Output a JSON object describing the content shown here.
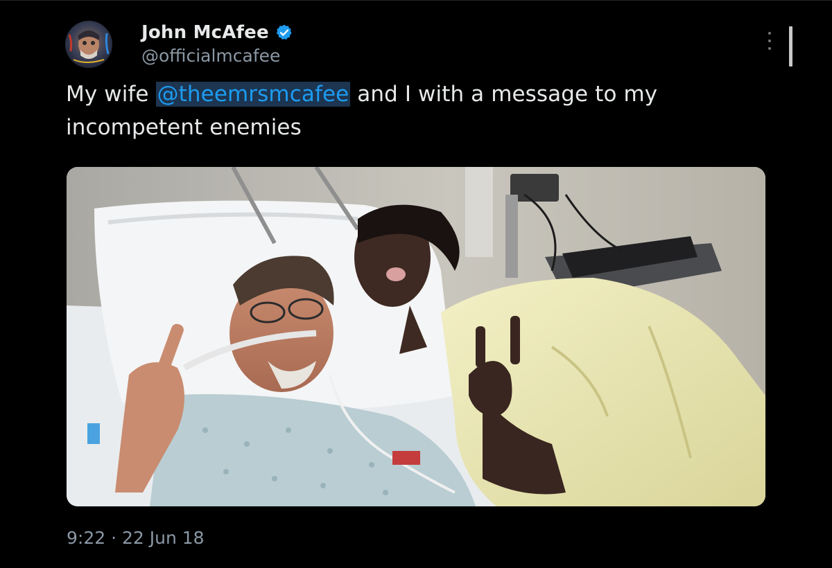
{
  "tweet": {
    "author": {
      "display_name": "John McAfee",
      "handle": "@officialmcafee",
      "verified": true,
      "avatar_icon": "profile-avatar"
    },
    "text_before": "My wife ",
    "mention": "@theemrsmcafee",
    "text_after": " and I with a message to my incompetent enemies",
    "time": "9:22",
    "separator": " · ",
    "date": "22 Jun 18",
    "media": {
      "type": "photo"
    }
  },
  "icons": {
    "verified": "verified-badge-icon",
    "more": "more-options-icon"
  },
  "colors": {
    "background": "#000000",
    "primary_text": "#e7e9ea",
    "secondary_text": "#8b98a5",
    "link": "#1d9bf0",
    "verified": "#1d9bf0",
    "mention_highlight": "#1d3550"
  }
}
